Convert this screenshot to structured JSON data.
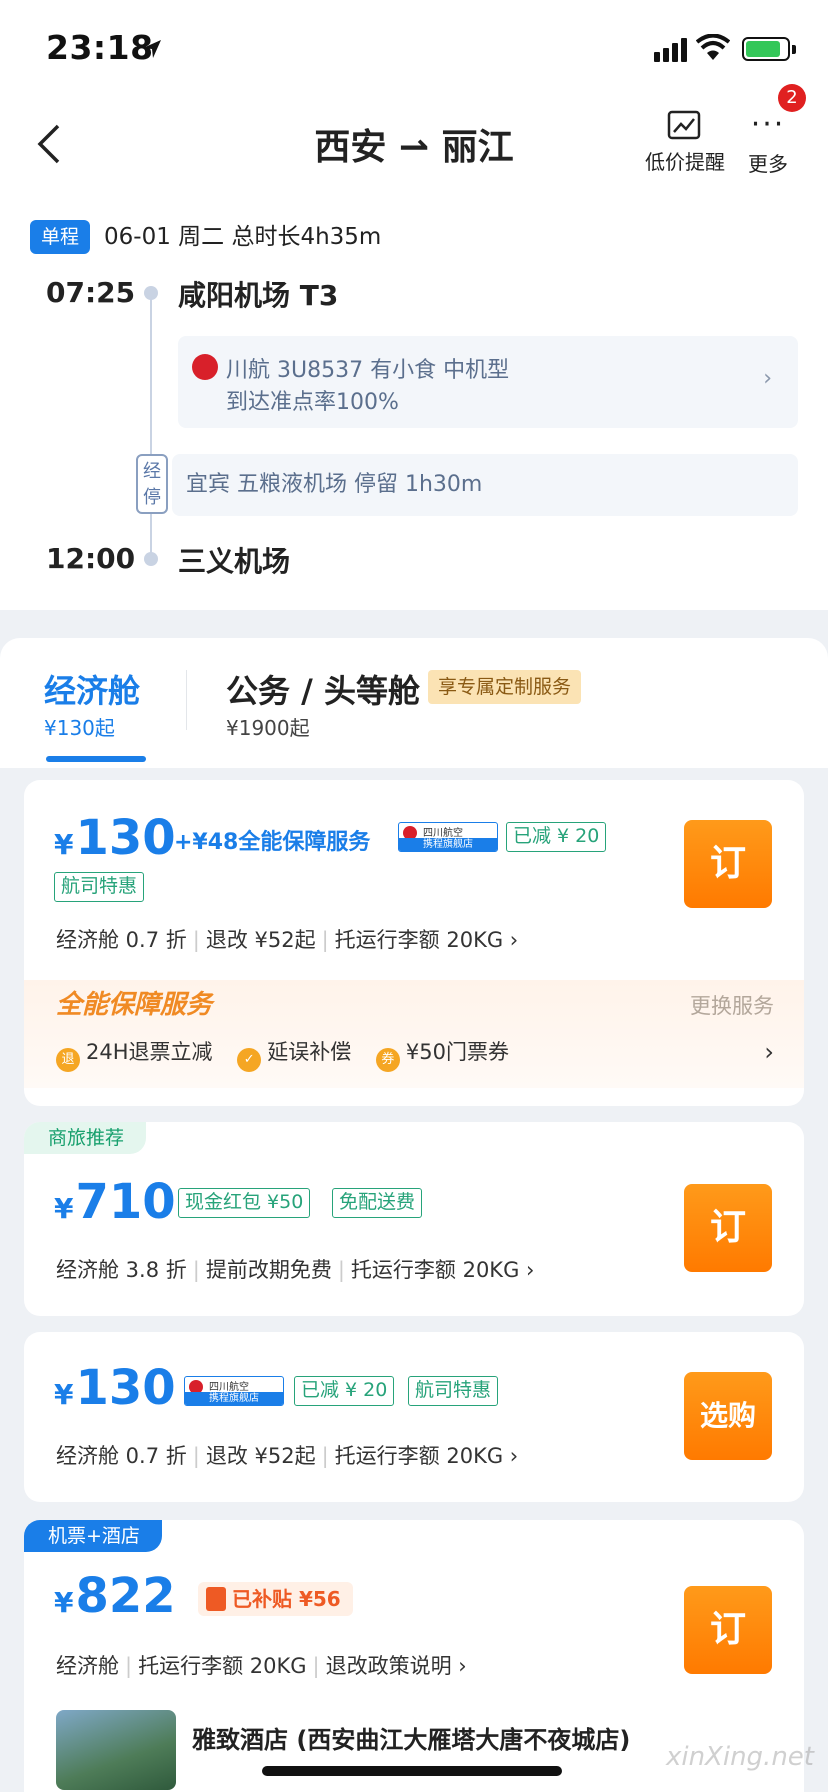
{
  "status_bar": {
    "time": "23:18"
  },
  "nav": {
    "title": "西安 ⇀ 丽江",
    "price_alert_label": "低价提醒",
    "more_label": "更多",
    "more_badge": "2"
  },
  "trip": {
    "type_badge": "单程",
    "date_summary": "06-01 周二    总时长4h35m",
    "departure_time": "07:25",
    "departure_airport": "咸阳机场 T3",
    "flight_line1": "川航 3U8537   有小食   中机型",
    "flight_line2": "到达准点率100%",
    "stop_tag": "经停",
    "stop_info": "宜宾   五粮液机场   停留 1h30m",
    "arrival_time": "12:00",
    "arrival_airport": "三义机场"
  },
  "cabin_tabs": {
    "economy_label": "经济舱",
    "economy_price": "¥130起",
    "business_label": "公务 / 头等舱",
    "business_price": "¥1900起",
    "business_tag": "享专属定制服务"
  },
  "fares": [
    {
      "price": "130",
      "bundle": "+¥48全能保障服务",
      "brand_top": "四川航空",
      "brand_bottom": "携程旗舰店",
      "discount_tag": "已减 ¥ 20",
      "special_tag": "航司特惠",
      "info": [
        "经济舱 0.7 折",
        "退改 ¥52起",
        "托运行李额 20KG ›"
      ],
      "button": "订",
      "service": {
        "title": "全能保障服务",
        "change": "更换服务",
        "items": [
          {
            "icon": "退",
            "text": "24H退票立减"
          },
          {
            "icon": "✓",
            "text": "延误补偿"
          },
          {
            "icon": "券",
            "text": "¥50门票券"
          }
        ]
      }
    },
    {
      "ribbon": "商旅推荐",
      "price": "710",
      "tags": [
        "现金红包 ¥50",
        "免配送费"
      ],
      "info": [
        "经济舱 3.8 折",
        "提前改期免费",
        "托运行李额 20KG ›"
      ],
      "button": "订"
    },
    {
      "price": "130",
      "brand_top": "四川航空",
      "brand_bottom": "携程旗舰店",
      "tags": [
        "已减 ¥ 20",
        "航司特惠"
      ],
      "info": [
        "经济舱 0.7 折",
        "退改 ¥52起",
        "托运行李额 20KG ›"
      ],
      "button": "选购"
    },
    {
      "ribbon": "机票+酒店",
      "price": "822",
      "subsidy": "已补贴 ¥56",
      "info": [
        "经济舱",
        "托运行李额 20KG",
        "退改政策说明 ›"
      ],
      "button": "订",
      "hotel_name": "雅致酒店 (西安曲江大雁塔大唐不夜城店)"
    }
  ],
  "watermark": "xinXing.net"
}
